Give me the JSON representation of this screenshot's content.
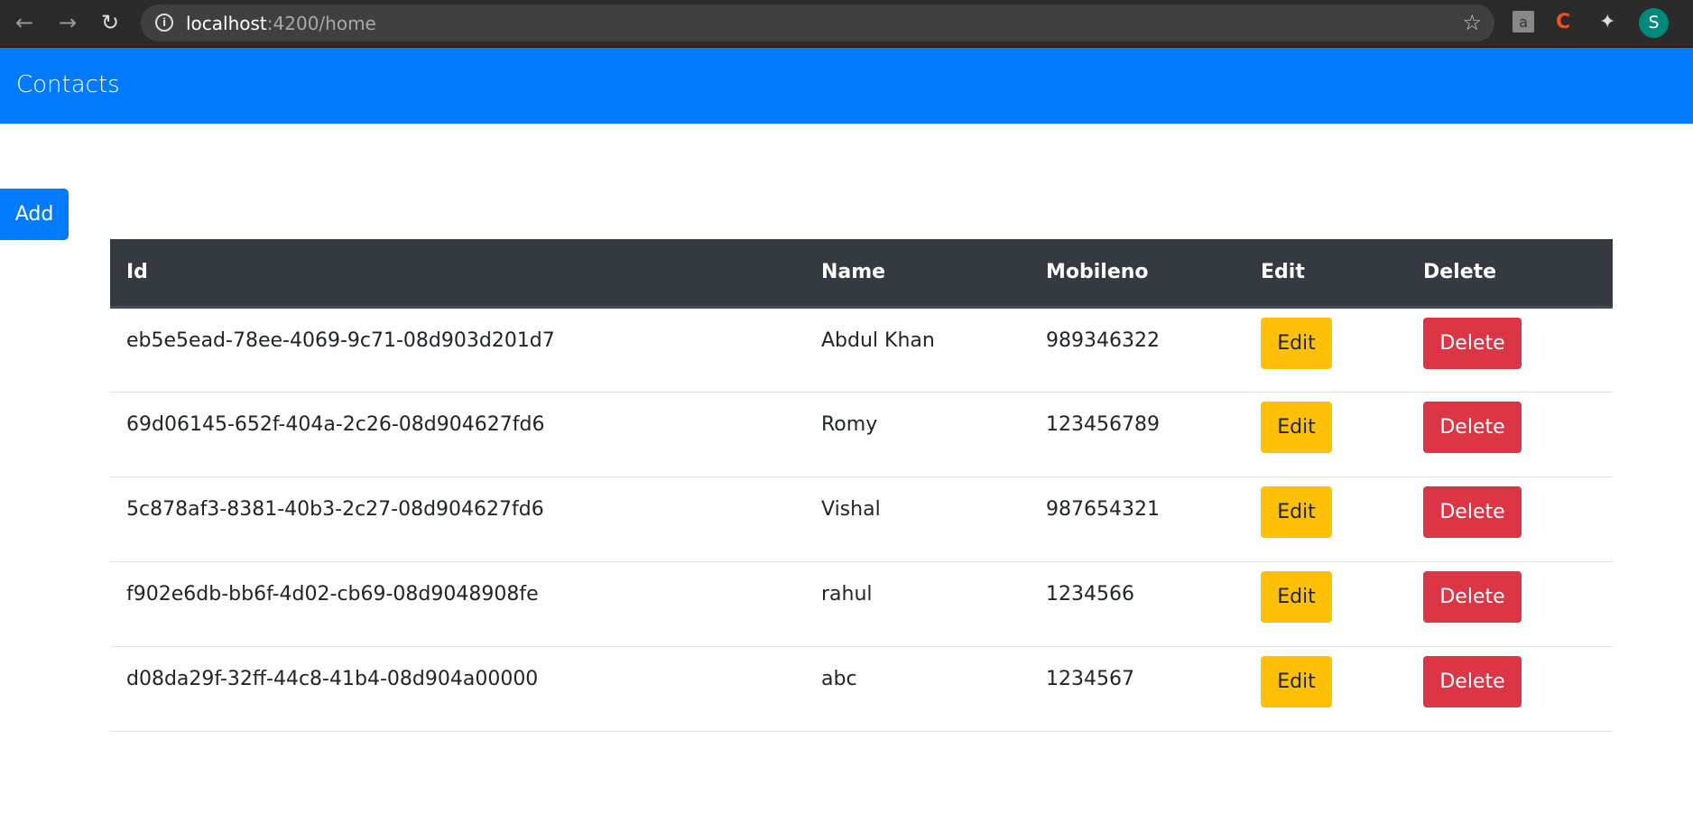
{
  "browser": {
    "url_host": "localhost",
    "url_path": ":4200/home",
    "avatar_letter": "S"
  },
  "navbar": {
    "brand": "Contacts"
  },
  "actions": {
    "add_label": "Add"
  },
  "table": {
    "headers": [
      "Id",
      "Name",
      "Mobileno",
      "Edit",
      "Delete"
    ],
    "rows": [
      {
        "id": "eb5e5ead-78ee-4069-9c71-08d903d201d7",
        "name": "Abdul Khan",
        "mobile": "989346322",
        "edit": "Edit",
        "delete": "Delete"
      },
      {
        "id": "69d06145-652f-404a-2c26-08d904627fd6",
        "name": "Romy",
        "mobile": "123456789",
        "edit": "Edit",
        "delete": "Delete"
      },
      {
        "id": "5c878af3-8381-40b3-2c27-08d904627fd6",
        "name": "Vishal",
        "mobile": "987654321",
        "edit": "Edit",
        "delete": "Delete"
      },
      {
        "id": "f902e6db-bb6f-4d02-cb69-08d9048908fe",
        "name": "rahul",
        "mobile": "1234566",
        "edit": "Edit",
        "delete": "Delete"
      },
      {
        "id": "d08da29f-32ff-44c8-41b4-08d904a00000",
        "name": "abc",
        "mobile": "1234567",
        "edit": "Edit",
        "delete": "Delete"
      }
    ]
  },
  "colors": {
    "primary": "#007bff",
    "warning": "#ffc107",
    "danger": "#dc3545",
    "dark": "#343a40"
  }
}
